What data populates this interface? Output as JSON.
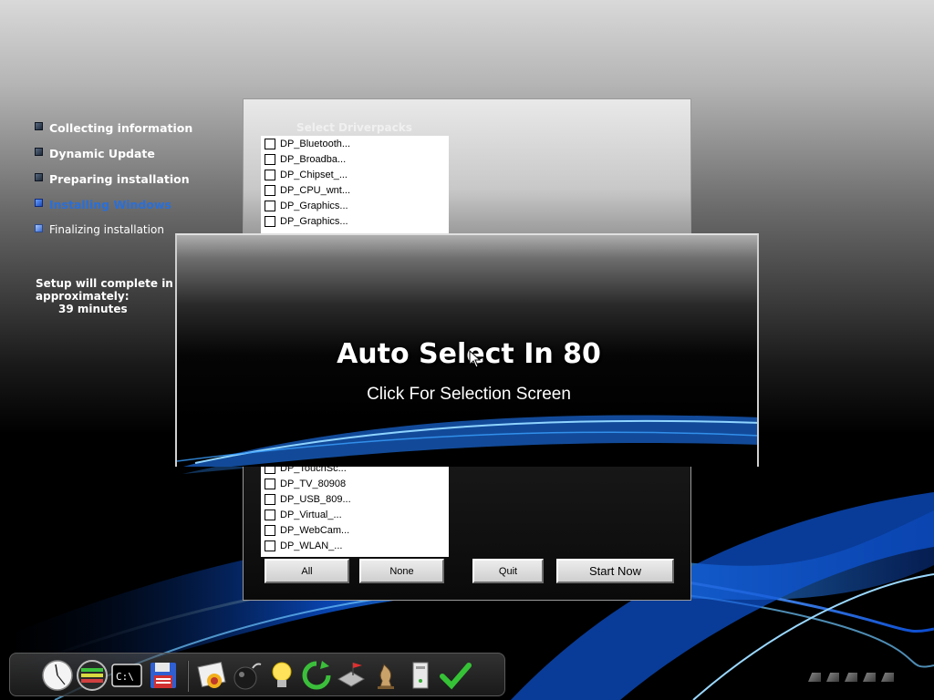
{
  "steps": [
    {
      "label": "Collecting information",
      "state": "done"
    },
    {
      "label": "Dynamic Update",
      "state": "done"
    },
    {
      "label": "Preparing installation",
      "state": "done"
    },
    {
      "label": "Installing Windows",
      "state": "active"
    },
    {
      "label": "Finalizing installation",
      "state": "pending"
    }
  ],
  "eta": {
    "line1": "Setup will complete in",
    "line2": "approximately:",
    "minutes": "39 minutes"
  },
  "driverpacks": {
    "title": "Select Driverpacks",
    "top_items": [
      "DP_Bluetooth...",
      "DP_Broadba...",
      "DP_Chipset_...",
      "DP_CPU_wnt...",
      "DP_Graphics...",
      "DP_Graphics..."
    ],
    "bottom_items": [
      "DP_TouchSc...",
      "DP_TV_80908",
      "DP_USB_809...",
      "DP_Virtual_...",
      "DP_WebCam...",
      "DP_WLAN_..."
    ],
    "buttons": {
      "all": "All",
      "none": "None",
      "quit": "Quit",
      "start_now": "Start Now"
    }
  },
  "auto_select": {
    "title": "Auto Select In 80",
    "subtitle": "Click For Selection Screen"
  },
  "dock": {
    "icons": [
      "clock-icon",
      "network-meter-icon",
      "command-prompt-icon",
      "floppy-disk-icon",
      "image-editor-icon",
      "bomb-icon",
      "lightbulb-icon",
      "refresh-icon",
      "network-flag-icon",
      "chess-piece-icon",
      "computer-tower-icon",
      "checkmark-icon"
    ]
  },
  "colors": {
    "active_step": "#2a6fd8",
    "swoosh_blue": "#1e8cff"
  }
}
